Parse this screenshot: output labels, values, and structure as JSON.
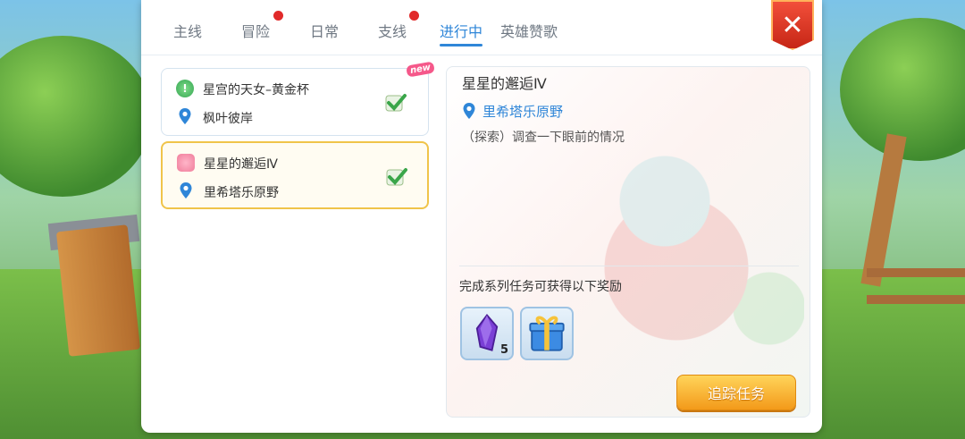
{
  "tabs": [
    {
      "label": "主线",
      "badge": false,
      "active": false
    },
    {
      "label": "冒险",
      "badge": true,
      "active": false
    },
    {
      "label": "日常",
      "badge": false,
      "active": false
    },
    {
      "label": "支线",
      "badge": true,
      "active": false
    },
    {
      "label": "进行中",
      "badge": false,
      "active": true
    },
    {
      "label": "英雄赞歌",
      "badge": false,
      "active": false
    }
  ],
  "quests": [
    {
      "title": "星宫的天女–黄金杯",
      "location": "枫叶彼岸",
      "icon": "green-quest-icon",
      "is_new": true,
      "new_label": "new",
      "selected": false,
      "completed": true
    },
    {
      "title": "星星的邂逅Ⅳ",
      "location": "里希塔乐原野",
      "icon": "pink-quest-icon",
      "is_new": false,
      "selected": true,
      "completed": true
    }
  ],
  "detail": {
    "title": "星星的邂逅Ⅳ",
    "location": "里希塔乐原野",
    "description": "（探索）调查一下眼前的情况",
    "reward_heading": "完成系列任务可获得以下奖励",
    "rewards": [
      {
        "icon": "purple-crystal-icon",
        "count": "5"
      },
      {
        "icon": "gift-box-icon",
        "count": ""
      }
    ]
  },
  "buttons": {
    "track": "追踪任务",
    "close": "✕"
  },
  "colors": {
    "accent": "#2f86d8",
    "badge_red": "#e12a2a",
    "selected_border": "#f0c44a",
    "track_button": "#f5a623",
    "close_button": "#d93a25"
  }
}
